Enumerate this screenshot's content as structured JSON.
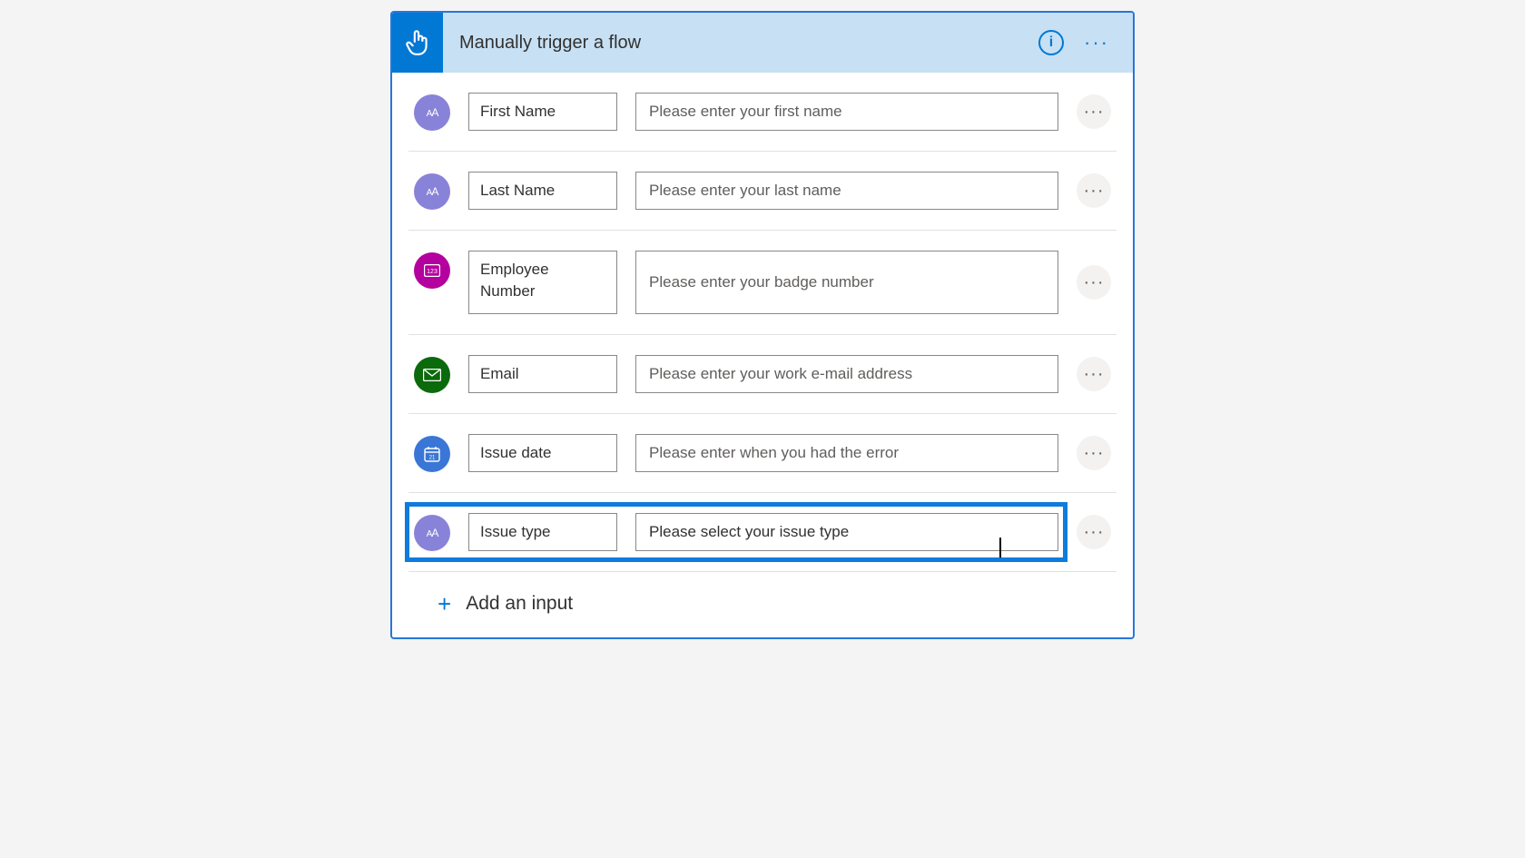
{
  "header": {
    "title": "Manually trigger a flow",
    "info_label": "i",
    "more_label": "···"
  },
  "rows": [
    {
      "type": "text",
      "name": "First Name",
      "desc": "Please enter your first name"
    },
    {
      "type": "text",
      "name": "Last Name",
      "desc": "Please enter your last name"
    },
    {
      "type": "number",
      "name": "Employee Number",
      "desc": "Please enter your badge number"
    },
    {
      "type": "email",
      "name": "Email",
      "desc": "Please enter your work e-mail address"
    },
    {
      "type": "date",
      "name": "Issue date",
      "desc": "Please enter when you had the error"
    },
    {
      "type": "text",
      "name": "Issue type",
      "desc": "Please select your issue type",
      "highlighted": true,
      "editing": true
    }
  ],
  "row_more_label": "···",
  "add_input": {
    "plus": "+",
    "label": "Add an input"
  }
}
